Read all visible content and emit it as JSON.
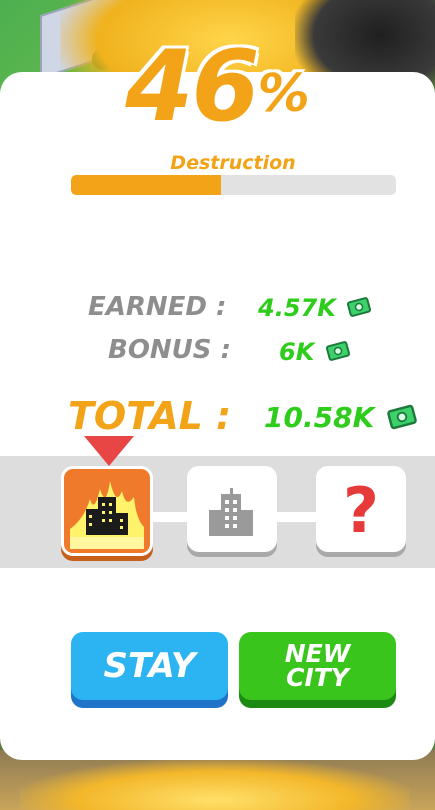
{
  "destruction": {
    "percent_value": "46",
    "percent_sign": "%",
    "label": "Destruction",
    "progress": 0.46
  },
  "rewards": {
    "earned_label": "EARNED :",
    "earned_value": "4.57K",
    "bonus_label": "BONUS :",
    "bonus_value": "6K",
    "total_label": "TOTAL :",
    "total_value": "10.58K"
  },
  "city_progress": {
    "current_index": 0,
    "tiles": [
      {
        "state": "current",
        "icon": "burning-city-icon"
      },
      {
        "state": "locked",
        "icon": "city-buildings-icon"
      },
      {
        "state": "unknown",
        "icon": "question-mark-icon",
        "text": "?"
      }
    ]
  },
  "buttons": {
    "stay_label": "STAY",
    "new_city_line1": "NEW",
    "new_city_line2": "CITY"
  },
  "colors": {
    "accent_orange": "#f2a317",
    "money_green": "#2ecc1b",
    "stay_blue": "#2cb4f2",
    "new_city_green": "#3ac51d",
    "pointer_red": "#e84545"
  }
}
